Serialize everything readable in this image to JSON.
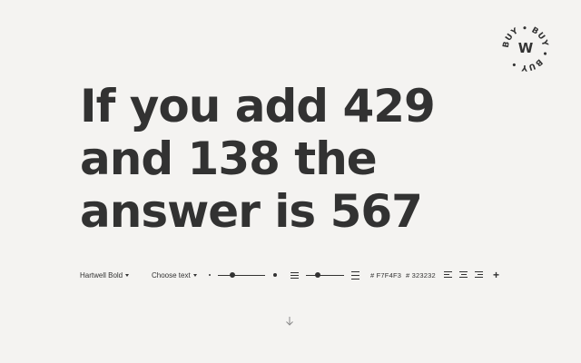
{
  "badge": {
    "ring_text": "BUY • BUY • BUY • ",
    "letter": "W"
  },
  "specimen": {
    "lines": [
      "If you add 429",
      "and 138 the",
      "answer is 567"
    ]
  },
  "toolbar": {
    "font_select": "Hartwell Bold",
    "text_select": "Choose text",
    "size_slider_level": 0.3,
    "leading_slider_level": 0.3,
    "background_color": "# F7F4F3",
    "text_color": "# 323232",
    "add_label": "+"
  },
  "icons": {
    "font_caret": "chevron-down-icon",
    "text_caret": "chevron-down-icon",
    "scroll": "arrow-down-icon",
    "align_left": "align-left-icon",
    "align_center": "align-center-icon",
    "align_right": "align-right-icon"
  },
  "colors": {
    "background": "#F4F3F1",
    "text": "#323232"
  }
}
